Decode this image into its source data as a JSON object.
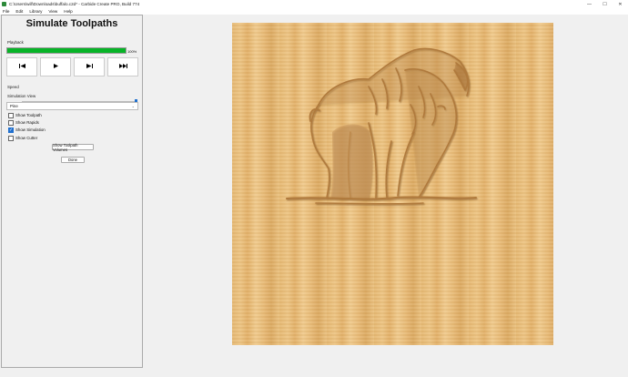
{
  "window": {
    "title": "C:\\Users\\will\\Downloads\\buffalo.c2d* - Carbide Create PRO, Build 774",
    "minimize": "—",
    "maximize": "☐",
    "close": "✕"
  },
  "menu": {
    "items": [
      "File",
      "Edit",
      "Library",
      "View",
      "Help"
    ]
  },
  "panel": {
    "title": "Simulate Toolpaths",
    "playback_label": "Playback",
    "progress_percent": 100,
    "progress_text": "100%",
    "buttons": {
      "first": "⏮",
      "play": "▶",
      "next": "⏭",
      "last": "⏭"
    },
    "speed_label": "Speed",
    "speed_level": 1.0,
    "sim_view_label": "Simulation View",
    "sim_view_value": "Pine",
    "options": [
      {
        "label": "Show Toolpath",
        "checked": false
      },
      {
        "label": "Show Rapids",
        "checked": false
      },
      {
        "label": "Show Simulation",
        "checked": true
      },
      {
        "label": "Show Cutter",
        "checked": false
      }
    ],
    "volumes_button": "Show Toolpath Volumes",
    "done_button": "Done"
  },
  "colors": {
    "progress": "#07b427",
    "accent": "#1f6fce",
    "wood": "#e8bb78"
  }
}
